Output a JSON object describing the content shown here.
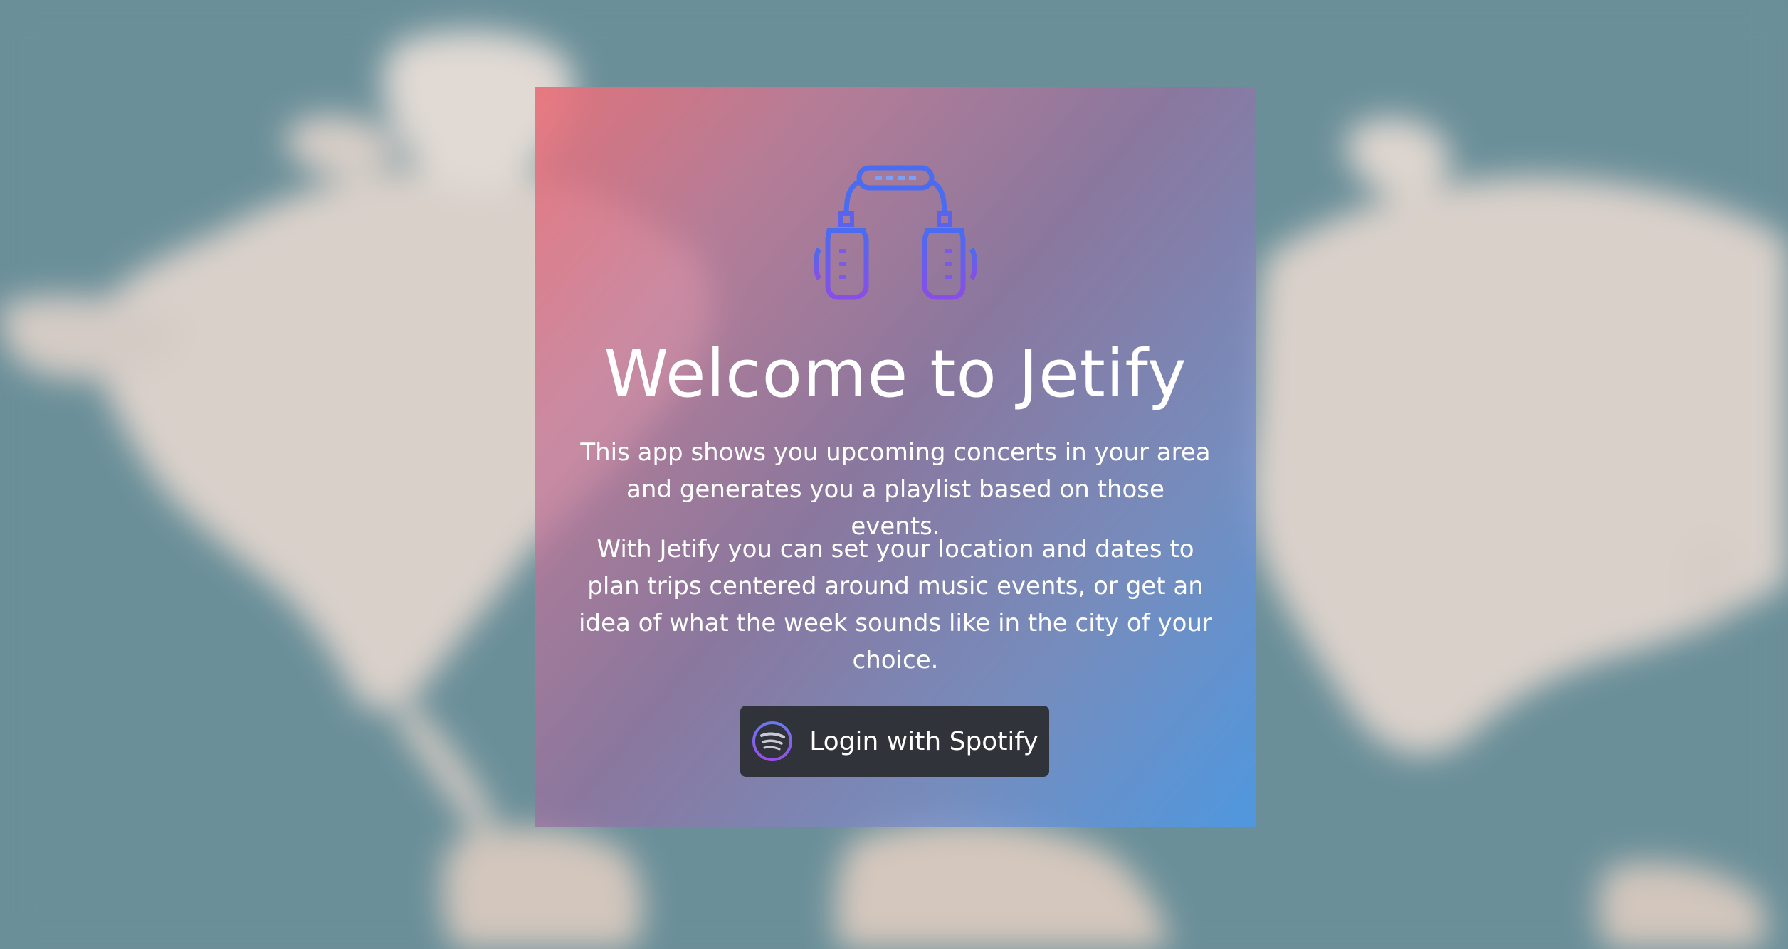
{
  "app": {
    "title": "Welcome to Jetify",
    "description_1": "This app shows you upcoming concerts in your area and generates you a playlist based on those events.",
    "description_2": "With Jetify you can set your location and dates to plan trips centered around music events, or get an idea of what the week sounds like in the city of your choice."
  },
  "login": {
    "label": "Login with Spotify",
    "icon": "spotify-icon"
  },
  "logo": {
    "icon": "headphones-icon"
  },
  "colors": {
    "ocean": "#6b8f99",
    "land": "#d9d0ca",
    "gradient_start": "#e87078",
    "gradient_end": "#4e98e2",
    "button_bg": "#30343a",
    "logo_blue": "#4a6cf0",
    "logo_purple": "#8a4ee6"
  }
}
